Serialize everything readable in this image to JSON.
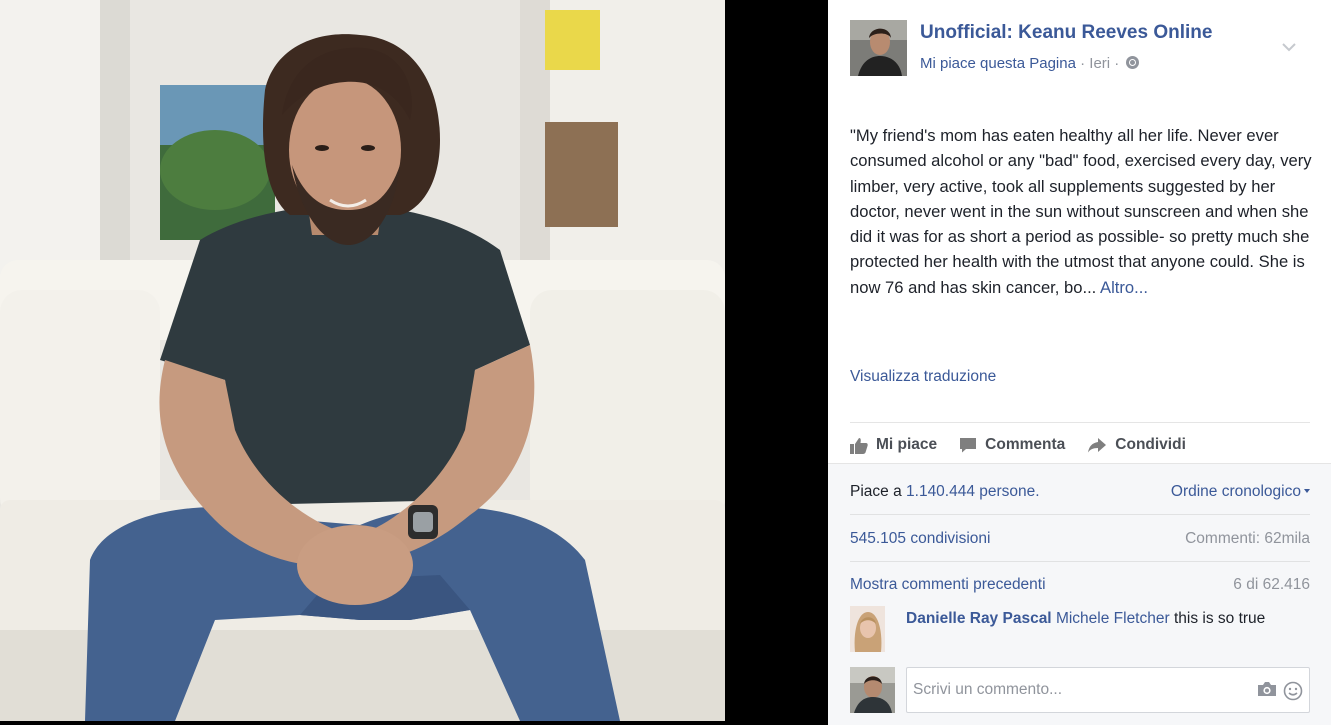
{
  "post": {
    "page_name": "Unofficial: Keanu Reeves Online",
    "like_page": "Mi piace questa Pagina",
    "separator": "·",
    "time": "Ieri",
    "text": "\"My friend's mom has eaten healthy all her life. Never ever consumed alcohol or any \"bad\" food, exercised every day, very limber, very active, took all supplements suggested by her doctor, never went in the sun without sunscreen and when she did it was for as short a period as possible- so pretty much she protected her health with the utmost that anyone could. She is now 76 and has skin cancer, bo...",
    "more_label": "Altro...",
    "translate_label": "Visualizza traduzione"
  },
  "actions": {
    "like": "Mi piace",
    "comment": "Commenta",
    "share": "Condividi"
  },
  "feedback": {
    "likes_prefix": "Piace a",
    "likes_count": "1.140.444 persone.",
    "sort_label": "Ordine cronologico",
    "shares": "545.105 condivisioni",
    "comments_count": "Commenti: 62mila",
    "previous_comments": "Mostra commenti precedenti",
    "comments_position": "6 di 62.416"
  },
  "comment": {
    "author": "Danielle Ray Pascal",
    "tagged": "Michele Fletcher",
    "text": "this is so true"
  },
  "composer": {
    "placeholder": "Scrivi un commento..."
  },
  "icons": {
    "page_options": "chevron-down-icon",
    "privacy": "globe-icon",
    "like": "thumbs-up-icon",
    "comment": "speech-bubble-icon",
    "share": "share-arrow-icon",
    "sort": "caret-down-icon",
    "photo": "camera-icon",
    "emoji": "smiley-icon"
  },
  "colors": {
    "link": "#3b5998",
    "text": "#1d2129",
    "muted": "#90949c",
    "feedback_bg": "#f6f7f9",
    "stage_bg": "#000000"
  }
}
